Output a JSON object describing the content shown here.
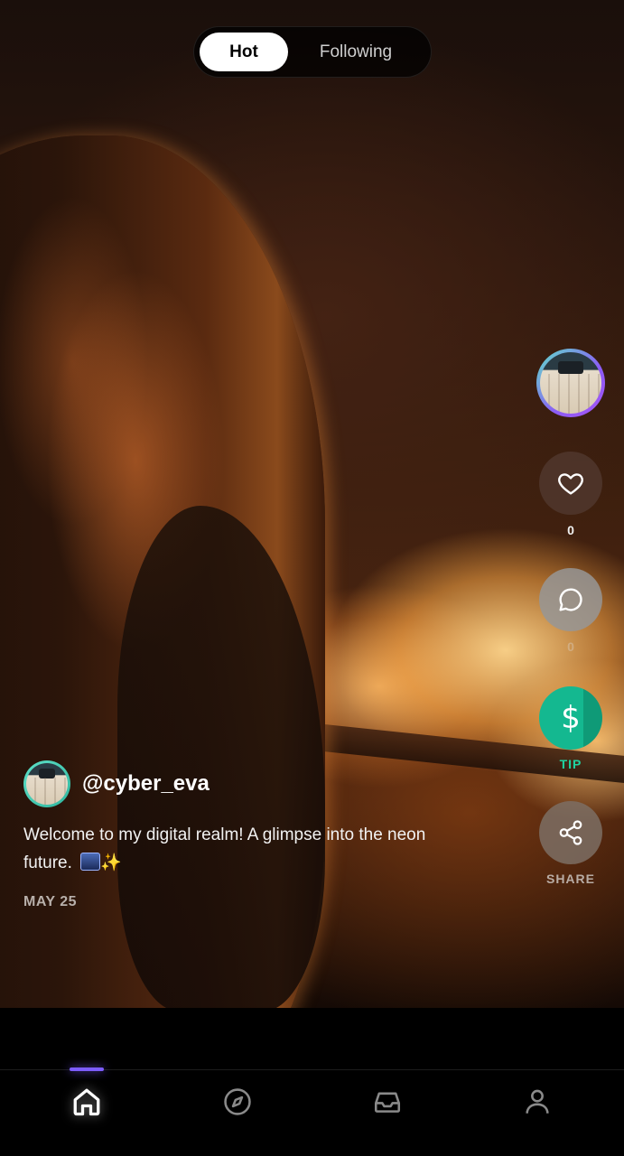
{
  "top_tabs": {
    "hot": "Hot",
    "following": "Following",
    "active": "hot"
  },
  "post": {
    "author": "@cyber_eva",
    "caption": "Welcome to my digital realm! A glimpse into the neon future.",
    "caption_emojis": [
      "city-night-emoji",
      "sparkles-emoji"
    ],
    "date": "MAY 25"
  },
  "actions": {
    "like_count": "0",
    "comment_count": "0",
    "tip_label": "TIP",
    "share_label": "SHARE"
  },
  "nav": {
    "items": [
      "home-icon",
      "explore-icon",
      "inbox-icon",
      "profile-icon"
    ],
    "active": "home"
  },
  "colors": {
    "accent": "#7c5cff",
    "tip": "#14b890",
    "avatar_ring": "#a855f7"
  }
}
